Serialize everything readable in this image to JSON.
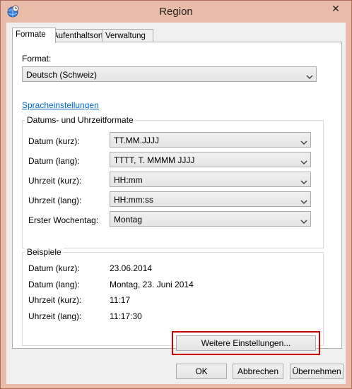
{
  "window": {
    "title": "Region",
    "close_symbol": "✕"
  },
  "tabs": [
    {
      "label": "Formate",
      "active": true
    },
    {
      "label": "Aufenthaltsort",
      "active": false
    },
    {
      "label": "Verwaltung",
      "active": false
    }
  ],
  "format": {
    "label": "Format:",
    "value": "Deutsch (Schweiz)"
  },
  "language_link": "Spracheinstellungen",
  "date_time_formats": {
    "group_title": "Datums- und Uhrzeitformate",
    "rows": [
      {
        "label": "Datum (kurz):",
        "value": "TT.MM.JJJJ"
      },
      {
        "label": "Datum (lang):",
        "value": "TTTT, T. MMMM JJJJ"
      },
      {
        "label": "Uhrzeit (kurz):",
        "value": "HH:mm"
      },
      {
        "label": "Uhrzeit (lang):",
        "value": "HH:mm:ss"
      },
      {
        "label": "Erster Wochentag:",
        "value": "Montag"
      }
    ]
  },
  "examples": {
    "group_title": "Beispiele",
    "rows": [
      {
        "label": "Datum (kurz):",
        "value": "23.06.2014"
      },
      {
        "label": "Datum (lang):",
        "value": "Montag, 23. Juni 2014"
      },
      {
        "label": "Uhrzeit (kurz):",
        "value": "11:17"
      },
      {
        "label": "Uhrzeit (lang):",
        "value": "11:17:30"
      }
    ]
  },
  "buttons": {
    "more_settings": "Weitere Einstellungen...",
    "ok": "OK",
    "cancel": "Abbrechen",
    "apply": "Übernehmen"
  },
  "icons": {
    "app": "globe-clock-icon",
    "dropdown": "chevron-down-icon",
    "close": "close-icon"
  },
  "colors": {
    "titlebar": "#e9bba9",
    "link": "#0066cc",
    "highlight": "#d10000"
  }
}
